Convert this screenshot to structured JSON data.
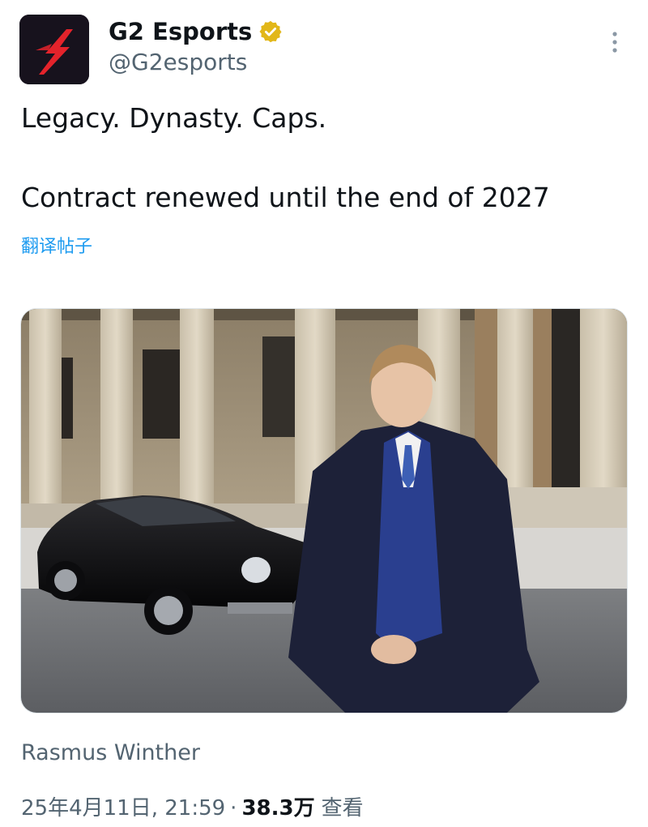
{
  "tweet": {
    "author": {
      "display_name": "G2 Esports",
      "handle": "@G2esports",
      "verified": true,
      "verified_icon": "verified-badge-icon",
      "verified_color": "#e2b719",
      "avatar_icon": "g2-logo-icon",
      "avatar_color": "#17121d",
      "logo_color": "#e4232b"
    },
    "more_icon": "more-vertical-icon",
    "text_lines": [
      "Legacy. Dynasty. Caps.",
      "Contract renewed until the end of 2027"
    ],
    "translate_label": "翻译帖子",
    "media": {
      "type": "photo",
      "icon": "photo-icon"
    },
    "photo_credit": "Rasmus Winther",
    "meta": {
      "date_time": "25年4月11日, 21:59",
      "separator": "·",
      "views_count": "38.3万",
      "views_label": "查看"
    }
  },
  "colors": {
    "text_primary": "#0f1419",
    "text_secondary": "#536471",
    "link": "#1d9bf0",
    "background": "#ffffff"
  }
}
